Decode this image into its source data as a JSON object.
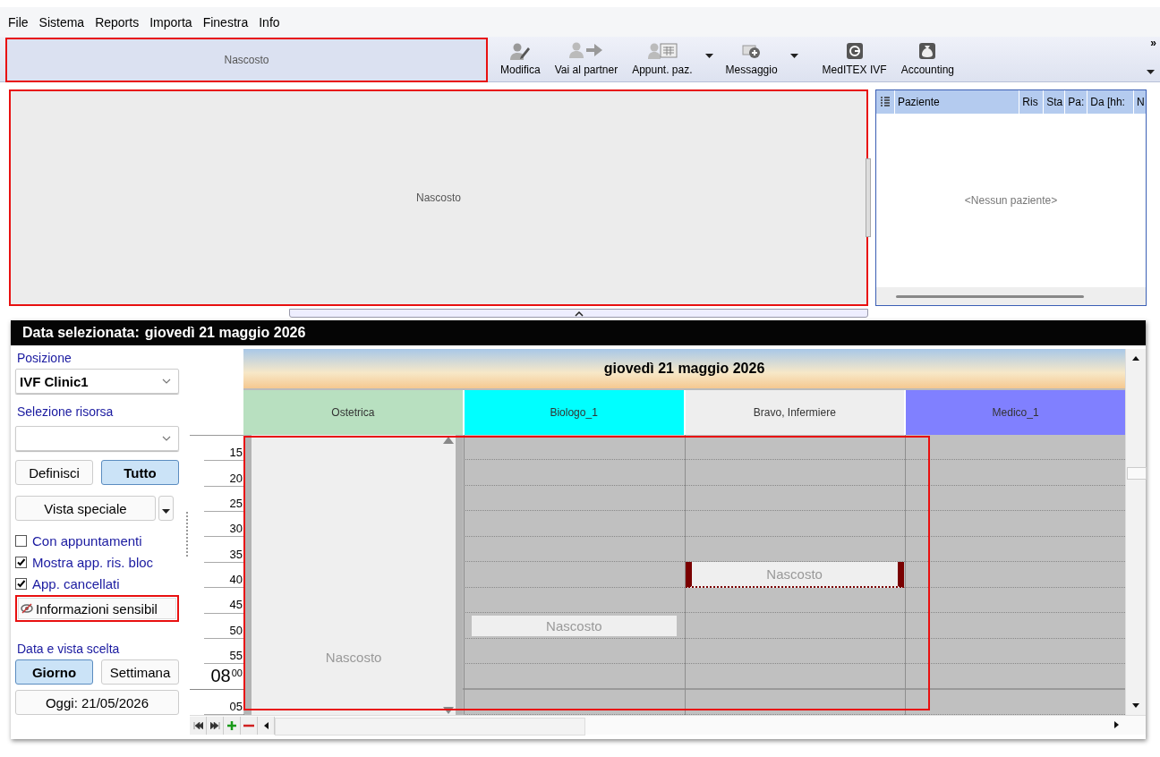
{
  "menu": [
    "File",
    "Sistema",
    "Reports",
    "Importa",
    "Finestra",
    "Info"
  ],
  "toolbar": {
    "hidden_panel": "Nascosto",
    "buttons": [
      {
        "label": "Modifica",
        "kind": "edit",
        "dropdown": false
      },
      {
        "label": "Vai al partner",
        "kind": "partner",
        "dropdown": false
      },
      {
        "label": "Appunt. paz.",
        "kind": "appointment",
        "dropdown": true
      },
      {
        "label": "Messaggio",
        "kind": "message",
        "dropdown": true
      },
      {
        "label": "MedITEX IVF",
        "kind": "app",
        "dropdown": false
      },
      {
        "label": "Accounting",
        "kind": "money",
        "dropdown": false
      }
    ],
    "overflow": "»"
  },
  "hidden_panel": {
    "text": "Nascosto"
  },
  "patient_list": {
    "columns": [
      "Paziente",
      "Ris",
      "Sta",
      "Pa:",
      "Da [hh:",
      "N"
    ],
    "empty_text": "<Nessun paziente>"
  },
  "calendar": {
    "selected_label": "Data selezionata:",
    "selected_date": "giovedì 21 maggio 2026",
    "sidebar": {
      "position_label": "Posizione",
      "position_value": "IVF Clinic1",
      "resource_label": "Selezione risorsa",
      "filter_buttons": [
        {
          "label": "Definisci",
          "selected": false
        },
        {
          "label": "Tutto",
          "selected": true
        }
      ],
      "special_view": "Vista speciale",
      "checkboxes": [
        {
          "label": "Con appuntamenti",
          "checked": false
        },
        {
          "label": "Mostra app. ris. bloc",
          "checked": true
        },
        {
          "label": "App. cancellati",
          "checked": true
        }
      ],
      "sensitive_button": "Informazioni sensibil",
      "view_label": "Data e vista scelta",
      "view_buttons": [
        {
          "label": "Giorno",
          "selected": true
        },
        {
          "label": "Settimana",
          "selected": false
        }
      ],
      "today_button": "Oggi: 21/05/2026"
    },
    "day_header": "giovedì 21 maggio 2026",
    "resources": [
      {
        "name": "Ostetrica",
        "color": "#b8e0c0",
        "appointments": [
          {
            "text": "Nascosto",
            "kind": "column"
          }
        ]
      },
      {
        "name": "Biologo_1",
        "color": "#00ffff",
        "appointments": [
          {
            "text": "Nascosto",
            "kind": "plain"
          }
        ]
      },
      {
        "name": "Bravo, Infermiere",
        "color": "#eeeeee",
        "appointments": [
          {
            "text": "Nascosto",
            "kind": "marked"
          }
        ]
      },
      {
        "name": "Medico_1",
        "color": "#8080ff"
      }
    ],
    "time_slots": [
      {
        "minute": "15"
      },
      {
        "minute": "20"
      },
      {
        "minute": "25"
      },
      {
        "minute": "30"
      },
      {
        "minute": "35"
      },
      {
        "minute": "40"
      },
      {
        "minute": "45"
      },
      {
        "minute": "50"
      },
      {
        "minute": "55"
      },
      {
        "hour": "08",
        "minute": "00"
      },
      {
        "minute": "05"
      }
    ]
  }
}
